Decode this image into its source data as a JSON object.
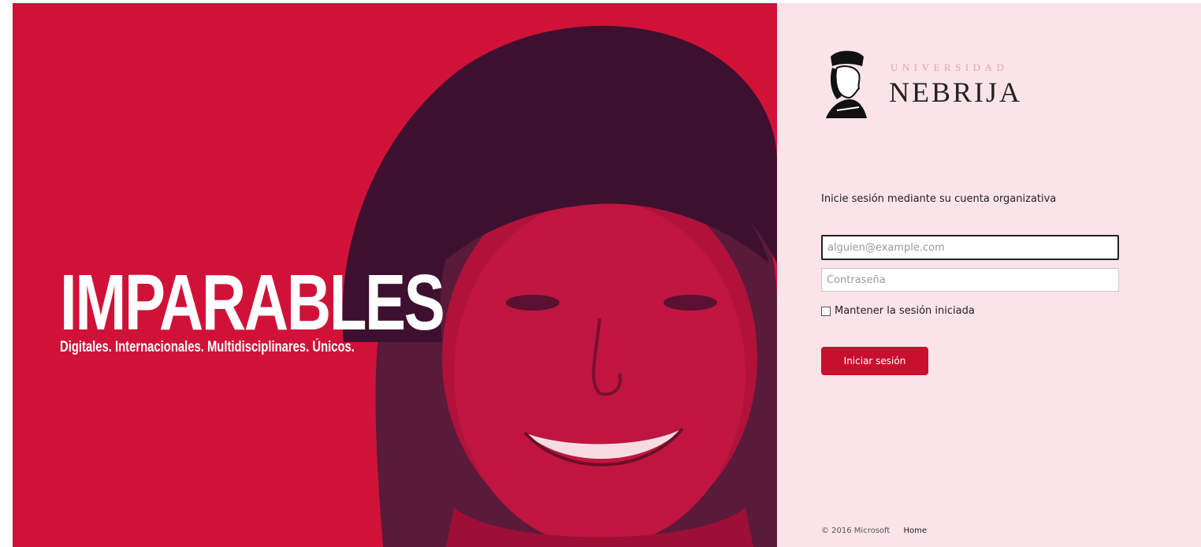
{
  "hero": {
    "title": "IMPARABLES",
    "subtitle": "Digitales. Internacionales. Multidisciplinares. Únicos.",
    "background_color": "#d11238"
  },
  "logo": {
    "small_text": "UNIVERSIDAD",
    "big_text": "NEBRIJA"
  },
  "login": {
    "intro": "Inicie sesión mediante su cuenta organizativa",
    "email_placeholder": "alguien@example.com",
    "email_value": "",
    "password_placeholder": "Contraseña",
    "password_value": "",
    "keep_signed_in_label": "Mantener la sesión iniciada",
    "keep_signed_in_checked": false,
    "submit_label": "Iniciar sesión",
    "accent_color": "#c8102e"
  },
  "footer": {
    "copyright": "© 2016 Microsoft",
    "home_link": "Home"
  }
}
